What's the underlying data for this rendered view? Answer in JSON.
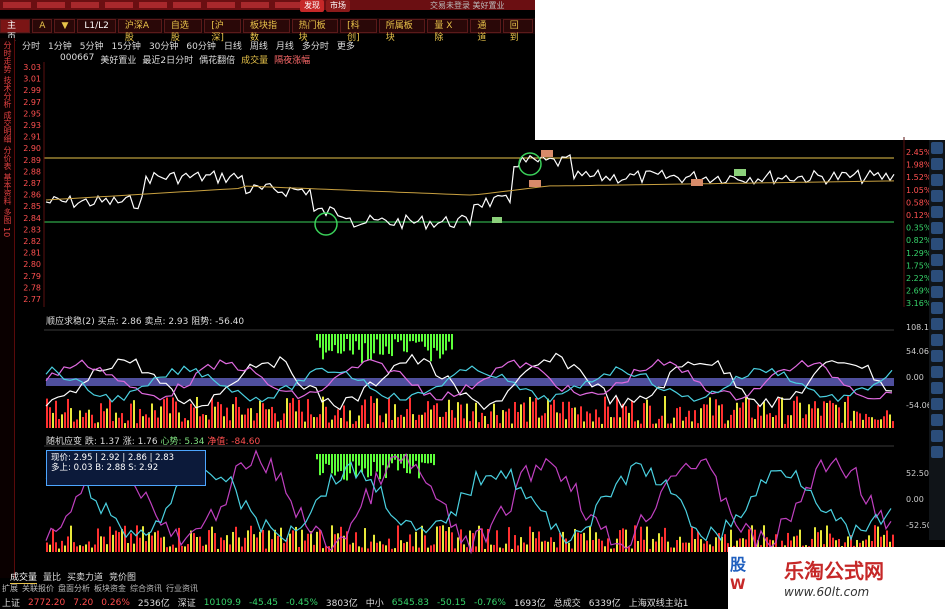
{
  "topbar": {
    "tabs": [
      "发现",
      "市场"
    ],
    "app_title": "交易未登录  美好置业"
  },
  "toolbar": {
    "buttons": [
      "主页",
      "A",
      "▼",
      "L1/L2",
      "沪深A股",
      "自选股",
      "[沪深]",
      "板块指数",
      "热门板块",
      "[科创]",
      "所属板块",
      "量 X 除",
      "通道",
      "回到"
    ]
  },
  "timeframes": [
    "分时",
    "1分钟",
    "5分钟",
    "15分钟",
    "30分钟",
    "60分钟",
    "日线",
    "周线",
    "月线",
    "多分时",
    "更多"
  ],
  "infobar": {
    "code": "000667",
    "name": "美好置业",
    "label1": "最近2日分时",
    "label2": "偶花翻倍",
    "label3": "成交量",
    "label4": "隔夜涨幅"
  },
  "side_tabs": [
    "分时走势",
    "技术分析",
    "成交明细",
    "分价表",
    "基本资料",
    "多图",
    "10"
  ],
  "price_axis": [
    "3.03",
    "3.01",
    "2.99",
    "2.97",
    "2.95",
    "2.93",
    "2.91",
    "2.89",
    "2.87",
    "2.85",
    "2.83",
    "2.81",
    "2.79",
    "2.77"
  ],
  "price_axis_left": [
    "3.03",
    "3.01",
    "2.99",
    "2.97",
    "2.95",
    "2.93",
    "2.91",
    "2.90",
    "2.89",
    "2.88",
    "2.87",
    "2.86",
    "2.85",
    "2.84",
    "2.83",
    "2.82",
    "2.81",
    "2.80",
    "2.79",
    "2.78",
    "2.77"
  ],
  "pct_axis": [
    "2.45%",
    "1.98%",
    "1.52%",
    "1.05%",
    "0.58%",
    "0.12%",
    "0.35%",
    "0.82%",
    "1.29%",
    "1.75%",
    "2.22%",
    "2.69%",
    "3.16%"
  ],
  "indicator1": {
    "title": "顺应求稳(2)",
    "buy_label": "买点: 2.86",
    "sell_label": "卖点: 2.93",
    "resist_label": "阻势: -56.40",
    "axis": [
      "108.11",
      "54.06",
      "0.00",
      "-54.06"
    ]
  },
  "indicator2": {
    "title": "随机应变",
    "v1": "跌: 1.37",
    "v2": "涨: 1.76",
    "v3": "心势: 5.34",
    "v4": "净值: -84.60",
    "axis": [
      "52.50",
      "0.00",
      "-52.50"
    ]
  },
  "tooltip": {
    "line1": "现价: 2.95 | 2.92 | 2.86 | 2.83",
    "line2": "多上: 0.03  B: 2.88  S: 2.92"
  },
  "bottom_tabs": [
    "成交量",
    "量比",
    "买卖力道",
    "竞价图"
  ],
  "bottom_tabs2": [
    "扩展",
    "关联报价",
    "盘面分析",
    "板块资金",
    "综合资讯",
    "行业资讯"
  ],
  "status": {
    "sh_label": "上证",
    "sh_value": "2772.20",
    "sh_change": "7.20",
    "sh_pct": "0.26%",
    "sh_amount": "2536亿",
    "sz_label": "深证",
    "sz_value": "10109.9",
    "sz_change": "-45.45",
    "sz_pct": "-0.45%",
    "sz_amount": "3803亿",
    "zx_label": "中小",
    "zx_value": "6545.83",
    "zx_change": "-50.15",
    "zx_pct": "-0.76%",
    "zx_amount": "1693亿",
    "total_label": "总成交",
    "total_value": "6339亿",
    "extra": "上海双线主站1"
  },
  "watermark": {
    "brand": "乐淘公式网",
    "url": "www.60lt.com",
    "logo_top": "股",
    "logo_bottom": "W"
  },
  "colors": {
    "price_line": "#ffffff",
    "avg_line": "#c8a040",
    "upper_line": "#e8c34a",
    "lower_line": "#3ad15a",
    "accent_red": "#c62828"
  }
}
